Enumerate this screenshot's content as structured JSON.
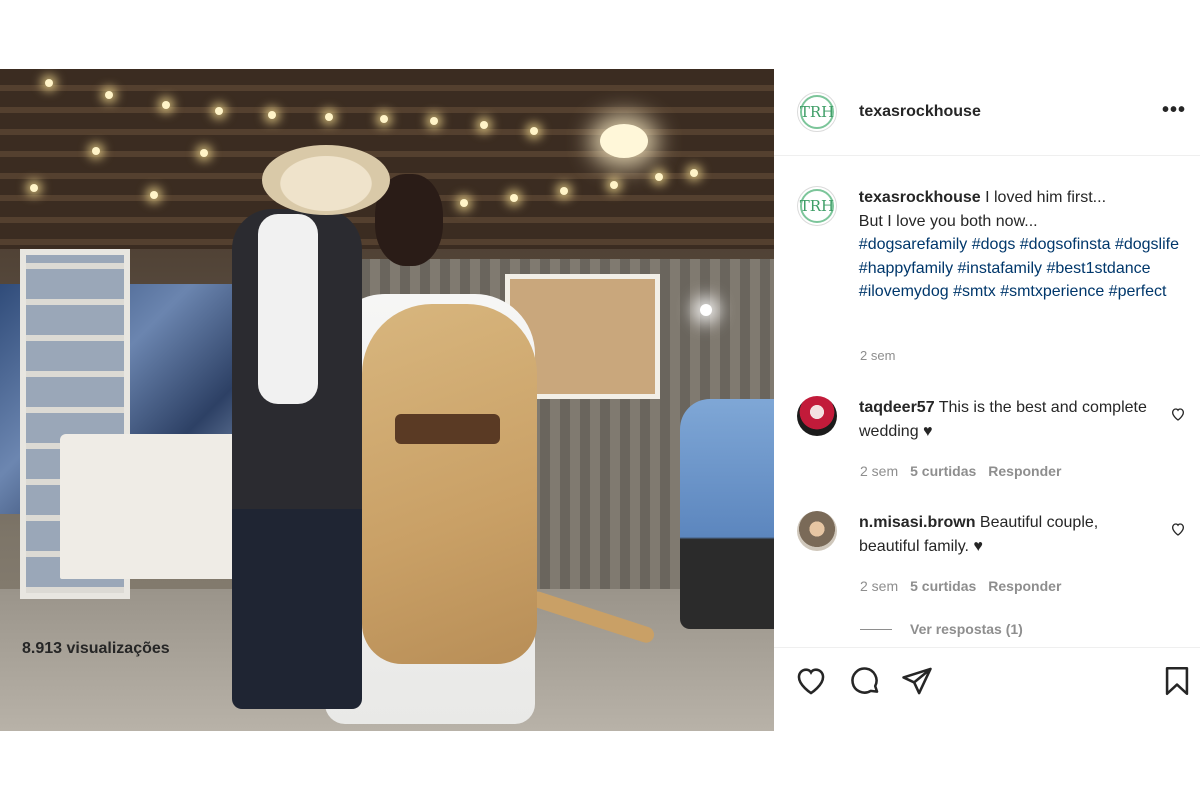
{
  "post": {
    "username": "texasrockhouse",
    "avatar_initials": "TRH",
    "more_label": "•••",
    "caption": {
      "username": "texasrockhouse",
      "text_line1": "I loved him first...",
      "text_line2": "But I love you both now...",
      "hashtags": "#dogsarefamily #dogs #dogsofinsta #dogslife #happyfamily #instafamily #best1stdance #ilovemydog #smtx #smtxperience #perfect",
      "time": "2 sem"
    },
    "comments": [
      {
        "username": "taqdeer57",
        "text": "This is the best and complete wedding ♥",
        "time": "2 sem",
        "likes": "5 curtidas",
        "reply_label": "Responder"
      },
      {
        "username": "n.misasi.brown",
        "text": "Beautiful couple, beautiful family. ♥",
        "time": "2 sem",
        "likes": "5 curtidas",
        "reply_label": "Responder"
      }
    ],
    "view_replies": "Ver respostas (1)",
    "views": "8.913 visualizações"
  },
  "icons": [
    "more-options-icon",
    "heart-icon",
    "comment-icon",
    "share-icon",
    "bookmark-icon"
  ],
  "colors": {
    "text": "#262626",
    "muted": "#8e8e8e",
    "hashtag": "#00376b",
    "logo_green": "#3f9e67"
  }
}
